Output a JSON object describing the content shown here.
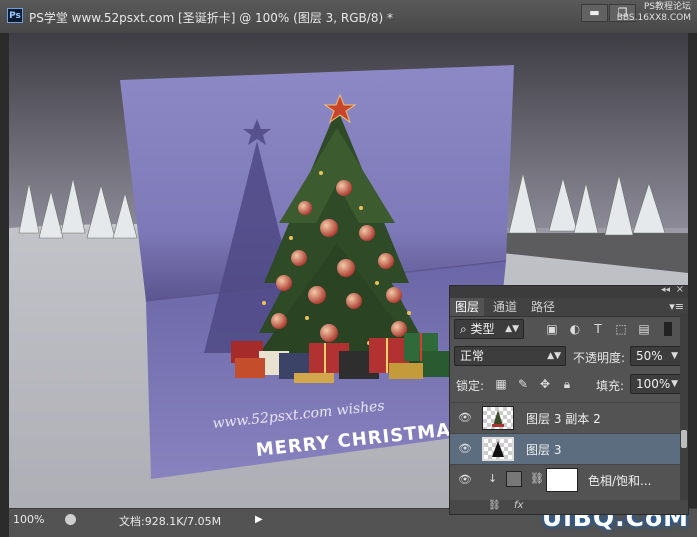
{
  "window": {
    "app_icon_label": "Ps",
    "title": "PS学堂 www.52psxt.com [圣诞折卡] @ 100% (图层 3, RGB/8) *",
    "minimize_label": "▬",
    "restore_label": "❐",
    "close_label": "×",
    "watermark_line1": "PS教程论坛",
    "watermark_line2": "BBS.16XX8.COM"
  },
  "canvas": {
    "card_text_line1": "www.52psxt.com  wishes",
    "card_text_line2": "MERRY CHRISTMAS"
  },
  "status_bar": {
    "zoom": "100%",
    "doc_info": "文档:928.1K/7.05M",
    "arrow": "▶",
    "watermark": "UiBQ.CoM"
  },
  "layers_panel": {
    "collapse_label": "◂◂",
    "close_label": "×",
    "tabs": [
      {
        "label": "图层",
        "active": true
      },
      {
        "label": "通道",
        "active": false
      },
      {
        "label": "路径",
        "active": false
      }
    ],
    "menu_label": "▾≡",
    "filter_type": "类型",
    "blend_mode": "正常",
    "opacity_label": "不透明度:",
    "opacity_value": "50%",
    "lock_label": "锁定:",
    "fill_label": "填充:",
    "fill_value": "100%",
    "layers": [
      {
        "name": "图层 3 副本 2",
        "active": false
      },
      {
        "name": "图层 3",
        "active": true
      },
      {
        "name": "色相/饱和...",
        "active": false
      }
    ],
    "bottom_icons": [
      "link-icon",
      "fx-icon"
    ],
    "bottom_fx_label": "fx"
  },
  "colors": {
    "card": "#8a86c4",
    "panel_bg": "#535353",
    "active_layer": "#5d6d80",
    "title_bar": "#4f4f4f"
  }
}
